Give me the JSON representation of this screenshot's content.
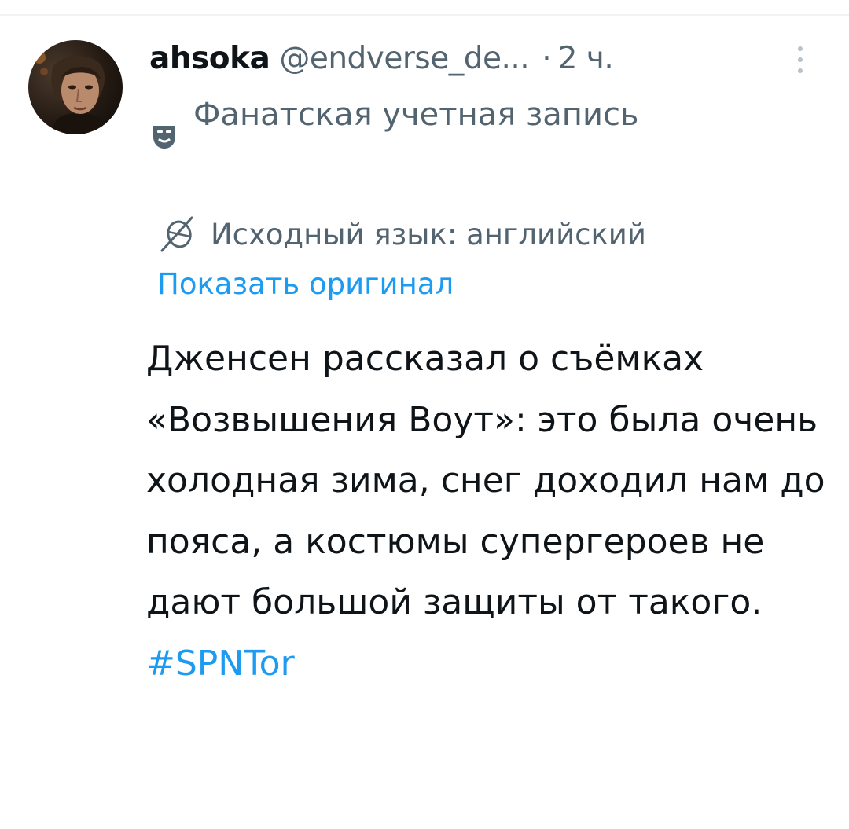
{
  "tweet": {
    "author": {
      "display_name": "ahsoka",
      "handle": "@endverse_de...",
      "avatar_icon": "profile-photo"
    },
    "separator": "·",
    "time": "2 ч.",
    "more_icon": "vertical-ellipsis-icon",
    "badge": {
      "icon": "theater-mask-icon",
      "label": "Фанатская учетная запись"
    },
    "translation": {
      "icon": "translate-globe-icon",
      "label": "Исходный язык: английский",
      "show_original": "Показать оригинал"
    },
    "body": {
      "text": "Дженсен рассказал о съёмках «Возвышения Воут»: это была очень холодная зима, снег доходил нам до пояса, а костюмы супергероев не дают большой защиты от такого.",
      "hashtag": "#SPNTor"
    }
  },
  "colors": {
    "primary_text": "#0f1419",
    "secondary_text": "#536471",
    "link": "#1d9bf0"
  }
}
